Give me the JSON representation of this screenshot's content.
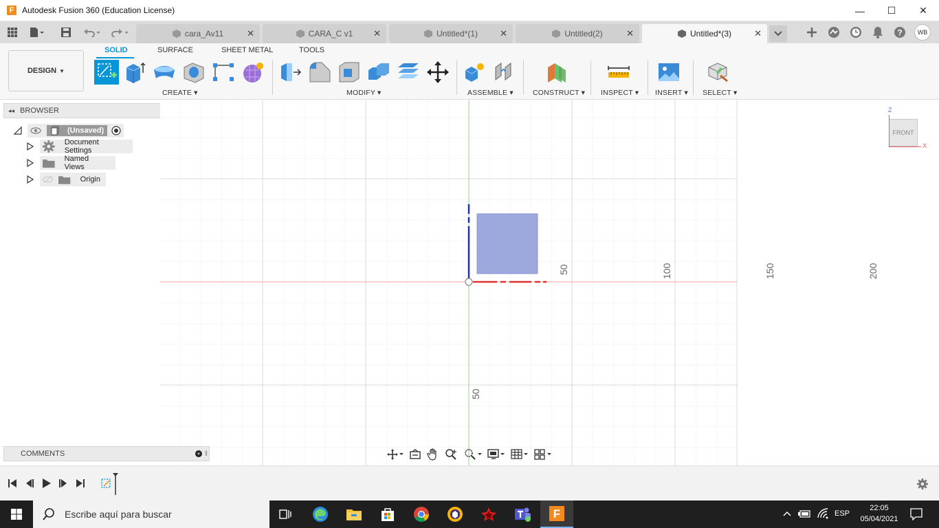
{
  "window": {
    "logo_letter": "F",
    "title": "Autodesk Fusion 360 (Education License)",
    "minimize": "—",
    "maximize": "☐",
    "close": "✕"
  },
  "tabs": [
    {
      "label": "cara_Av11",
      "active": false
    },
    {
      "label": "CARA_C v1",
      "active": false
    },
    {
      "label": "Untitled*(1)",
      "active": false
    },
    {
      "label": "Untitled(2)",
      "active": false
    },
    {
      "label": "Untitled*(3)",
      "active": true
    }
  ],
  "tab_close": "✕",
  "user_initials": "WB",
  "workspace": {
    "mode": "DESIGN",
    "tabs": [
      "SOLID",
      "SURFACE",
      "SHEET METAL",
      "TOOLS"
    ],
    "active_tab": "SOLID"
  },
  "groups": {
    "create": "CREATE",
    "modify": "MODIFY",
    "assemble": "ASSEMBLE",
    "construct": "CONSTRUCT",
    "inspect": "INSPECT",
    "insert": "INSERT",
    "select": "SELECT"
  },
  "browser": {
    "title": "BROWSER",
    "root": "(Unsaved)",
    "items": [
      "Document Settings",
      "Named Views",
      "Origin"
    ]
  },
  "comments": {
    "title": "COMMENTS"
  },
  "viewcube": {
    "face": "FRONT",
    "axis_z": "Z",
    "axis_x": "X"
  },
  "axis_labels": {
    "h50": "50",
    "h100": "100",
    "h150": "150",
    "h200": "200",
    "v50": "50"
  },
  "taskbar": {
    "search_placeholder": "Escribe aquí para buscar",
    "language": "ESP",
    "time": "22:05",
    "date": "05/04/2021"
  },
  "colors": {
    "accent": "#0696d7",
    "fusion_orange": "#f28a1d",
    "sketch_fill": "#9ea8dc",
    "x_axis": "#e03030",
    "z_axis": "#1a2dd8",
    "y_axis": "#6cc86c"
  }
}
